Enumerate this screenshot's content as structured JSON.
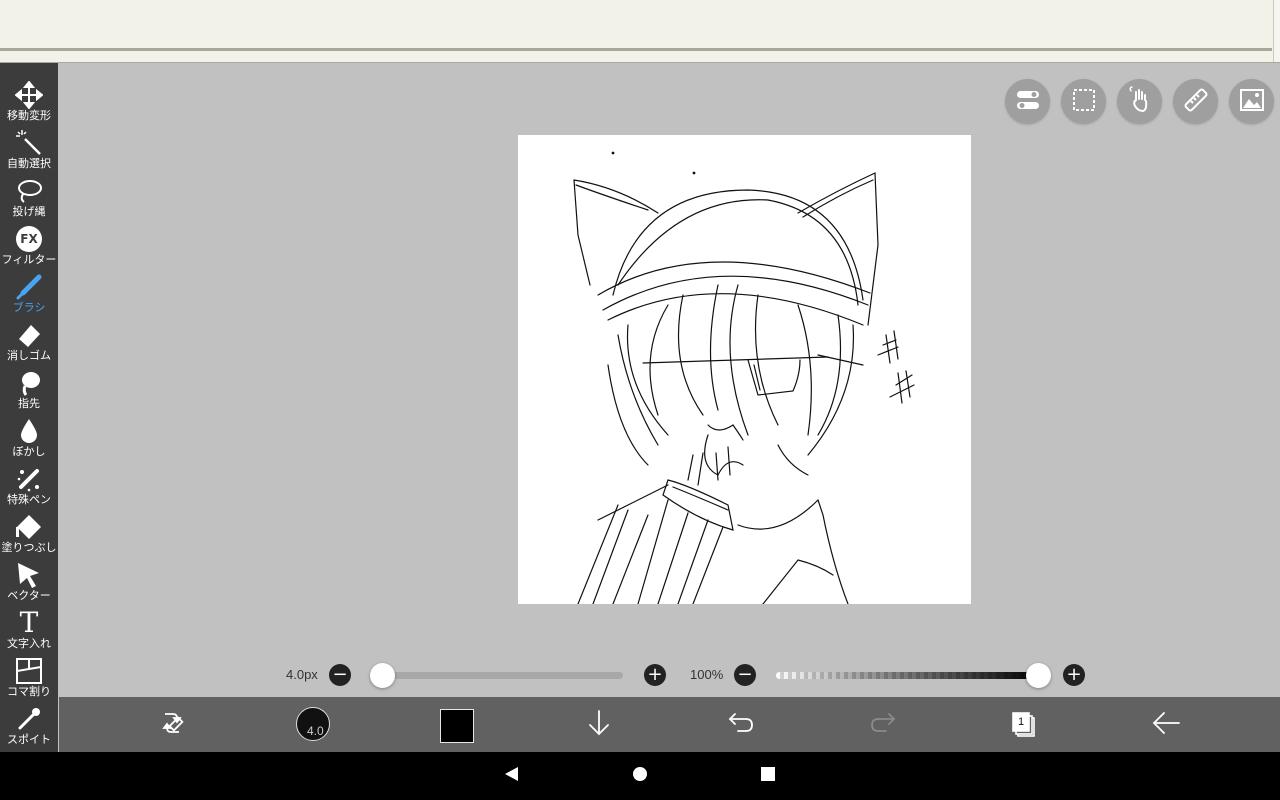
{
  "toolbar": {
    "tools": [
      {
        "label": "移動変形",
        "icon": "move-icon"
      },
      {
        "label": "自動選択",
        "icon": "magic-wand-icon"
      },
      {
        "label": "投げ縄",
        "icon": "lasso-icon"
      },
      {
        "label": "フィルター",
        "icon": "fx-icon"
      },
      {
        "label": "ブラシ",
        "icon": "brush-icon",
        "active": true
      },
      {
        "label": "消しゴム",
        "icon": "eraser-icon"
      },
      {
        "label": "指先",
        "icon": "finger-smudge-icon"
      },
      {
        "label": "ぼかし",
        "icon": "blur-drop-icon"
      },
      {
        "label": "特殊ペン",
        "icon": "special-pen-icon"
      },
      {
        "label": "塗りつぶし",
        "icon": "fill-bucket-icon"
      },
      {
        "label": "ベクター",
        "icon": "vector-cursor-icon"
      },
      {
        "label": "文字入れ",
        "icon": "text-icon"
      },
      {
        "label": "コマ割り",
        "icon": "frame-divider-icon"
      },
      {
        "label": "スポイト",
        "icon": "eyedropper-icon"
      }
    ],
    "fx_text": "FX",
    "text_tool_glyph": "T",
    "active_color": "#4aa3f0"
  },
  "top_right_buttons": [
    "toggle-settings-icon",
    "selection-marquee-icon",
    "hand-gesture-icon",
    "ruler-icon",
    "reference-image-icon"
  ],
  "sliders": {
    "brush_size_label": "4.0px",
    "brush_size_value": 4.0,
    "brush_size_fraction": 0.0,
    "opacity_label": "100%",
    "opacity_fraction": 1.0,
    "minus_glyph": "−",
    "plus_glyph": "+"
  },
  "bottom_bar": {
    "brush_size_text": "4.0",
    "color": "#000000",
    "layer_count": "1"
  },
  "navigation": [
    "back-triangle-icon",
    "home-circle-icon",
    "recents-square-icon"
  ]
}
